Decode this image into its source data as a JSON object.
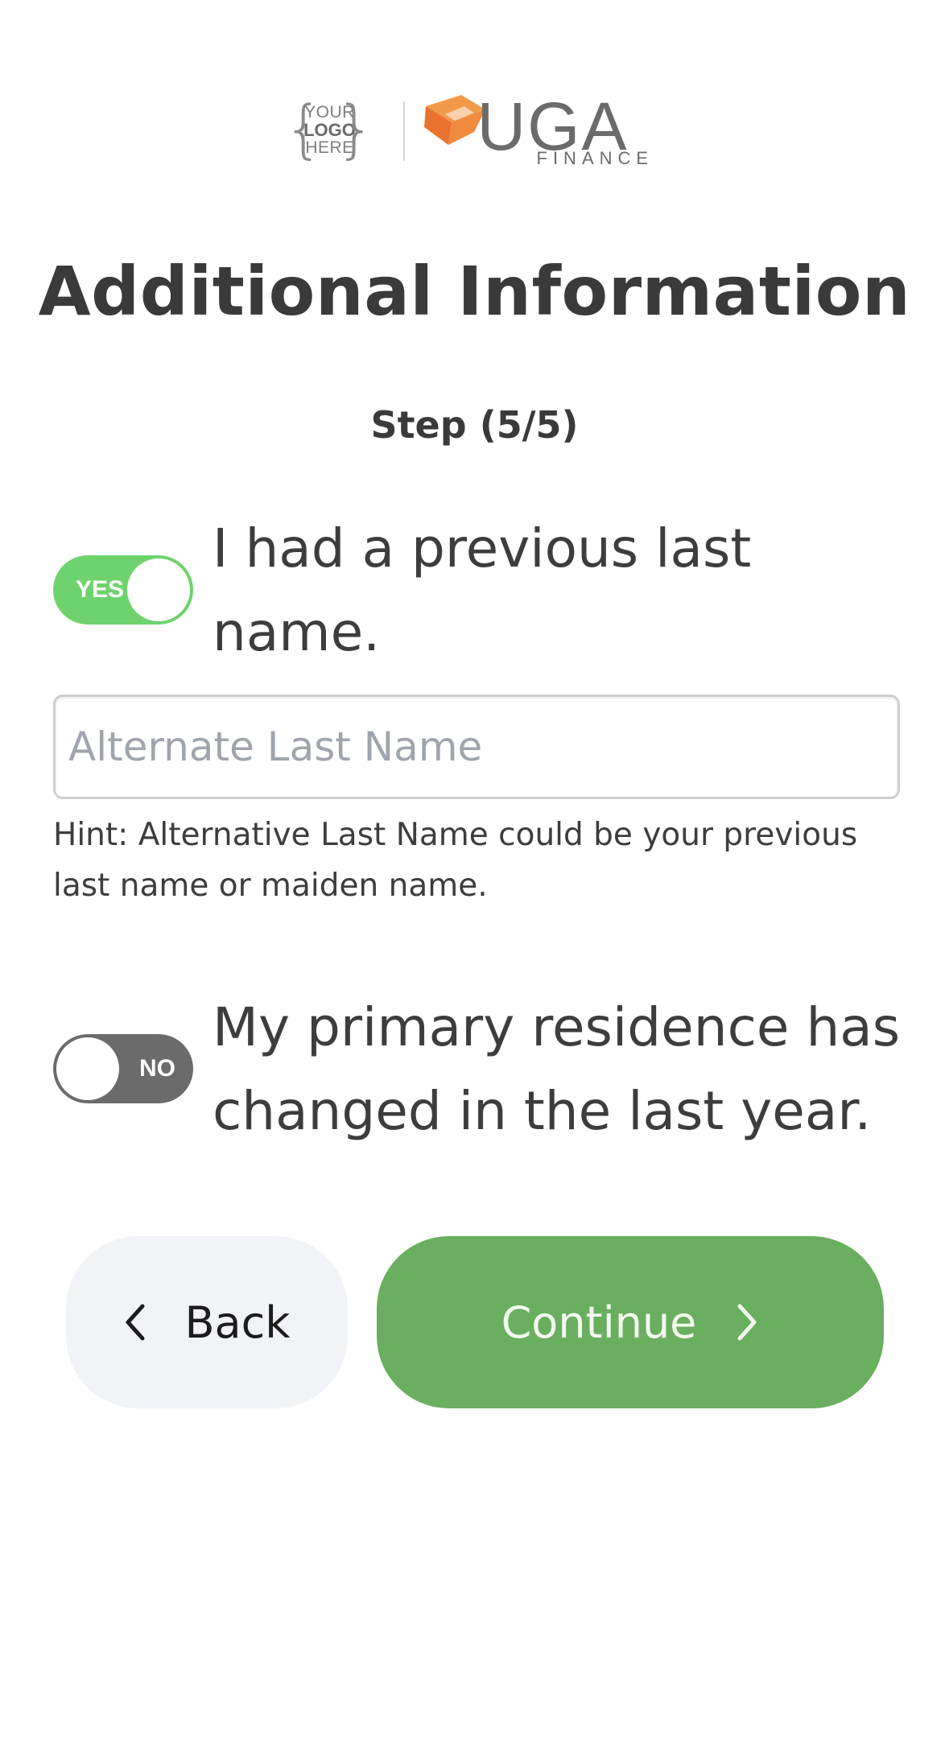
{
  "header": {
    "placeholder_logo": {
      "line1": "YOUR",
      "line2": "LOGO",
      "line3": "HERE"
    },
    "brand_logo": {
      "letters": "UGA",
      "subtitle": "FINANCE"
    }
  },
  "page": {
    "title": "Additional Information",
    "step": "Step (5/5)"
  },
  "previous_last_name": {
    "toggle_state": "YES",
    "toggle_on": true,
    "label": "I had a previous last name.",
    "input_value": "",
    "input_placeholder": "Alternate Last Name",
    "hint": "Hint: Alternative Last Name could be your previous last name or maiden name."
  },
  "residence_changed": {
    "toggle_state": "NO",
    "toggle_on": false,
    "label": "My primary residence has changed in the last year."
  },
  "actions": {
    "back_label": "Back",
    "continue_label": "Continue",
    "back_icon": "chevron-left-icon",
    "continue_icon": "chevron-right-icon"
  },
  "colors": {
    "toggle_on": "#6ed36e",
    "toggle_off": "#6b6b6b",
    "continue_button": "#6aae5f",
    "back_button": "#f2f3f7",
    "brand_orange": "#f08a3c"
  }
}
